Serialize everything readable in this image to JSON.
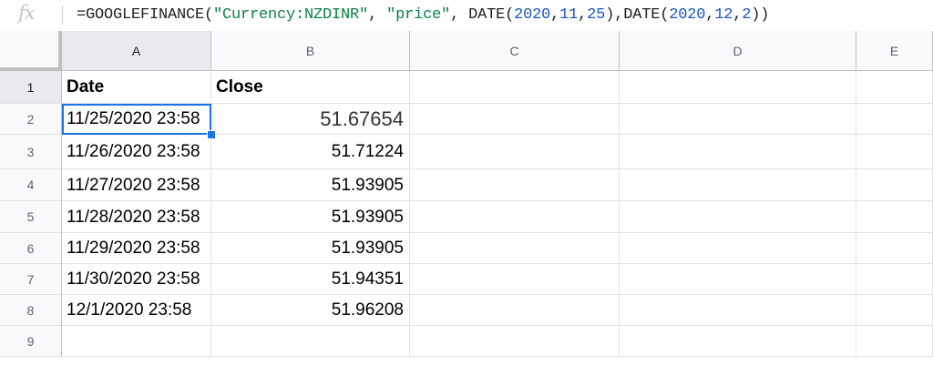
{
  "formula_bar": {
    "fx_label": "fx",
    "parts": [
      {
        "text": "=GOOGLEFINANCE(",
        "kind": "plain"
      },
      {
        "text": "\"Currency:NZDINR\"",
        "kind": "str"
      },
      {
        "text": ", ",
        "kind": "plain"
      },
      {
        "text": "\"price\"",
        "kind": "str"
      },
      {
        "text": ", DATE(",
        "kind": "plain"
      },
      {
        "text": "2020",
        "kind": "num"
      },
      {
        "text": ",",
        "kind": "plain"
      },
      {
        "text": "11",
        "kind": "num"
      },
      {
        "text": ",",
        "kind": "plain"
      },
      {
        "text": "25",
        "kind": "num"
      },
      {
        "text": "),DATE(",
        "kind": "plain"
      },
      {
        "text": "2020",
        "kind": "num"
      },
      {
        "text": ",",
        "kind": "plain"
      },
      {
        "text": "12",
        "kind": "num"
      },
      {
        "text": ",",
        "kind": "plain"
      },
      {
        "text": "2",
        "kind": "num"
      },
      {
        "text": "))",
        "kind": "plain"
      }
    ]
  },
  "columns": [
    "A",
    "B",
    "C",
    "D",
    "E"
  ],
  "selected_column": "A",
  "selected_row": "1",
  "rows": [
    {
      "num": "1",
      "a": "Date",
      "b": "Close"
    },
    {
      "num": "2",
      "a": "11/25/2020 23:58",
      "b": "51.67654"
    },
    {
      "num": "3",
      "a": "11/26/2020 23:58",
      "b": "51.71224"
    },
    {
      "num": "4",
      "a": "11/27/2020 23:58",
      "b": "51.93905"
    },
    {
      "num": "5",
      "a": "11/28/2020 23:58",
      "b": "51.93905"
    },
    {
      "num": "6",
      "a": "11/29/2020 23:58",
      "b": "51.93905"
    },
    {
      "num": "7",
      "a": "11/30/2020 23:58",
      "b": "51.94351"
    },
    {
      "num": "8",
      "a": "12/1/2020 23:58",
      "b": "51.96208"
    },
    {
      "num": "9",
      "a": "",
      "b": ""
    }
  ]
}
